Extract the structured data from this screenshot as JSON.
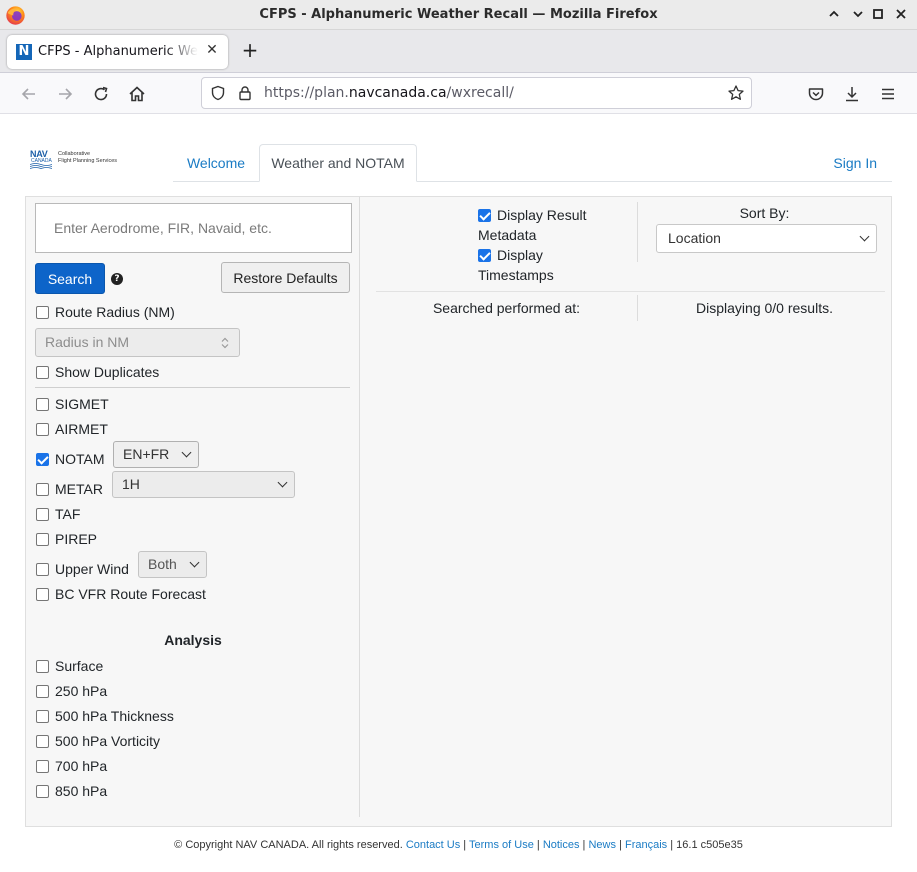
{
  "window": {
    "title": "CFPS - Alphanumeric Weather Recall — Mozilla Firefox"
  },
  "browser": {
    "tab_title": "CFPS - Alphanumeric Weather Recall",
    "favicon_letter": "N",
    "url_prefix": "https://plan.",
    "url_domain": "navcanada.ca",
    "url_path": "/wxrecall/"
  },
  "logo": {
    "brand": "NAV",
    "sub": "CANADA",
    "tagline_1": "Collaborative",
    "tagline_2": "Flight Planning Services"
  },
  "topnav": {
    "welcome": "Welcome",
    "weather_notam": "Weather and NOTAM",
    "sign_in": "Sign In"
  },
  "search": {
    "placeholder": "Enter Aerodrome, FIR, Navaid, etc.",
    "value": "",
    "search_label": "Search",
    "help": "?",
    "restore_label": "Restore Defaults"
  },
  "options": {
    "route_radius": {
      "label": "Route Radius (NM)",
      "checked": false
    },
    "radius_placeholder": "Radius in NM",
    "show_duplicates": {
      "label": "Show Duplicates",
      "checked": false
    }
  },
  "products": [
    {
      "label": "SIGMET",
      "checked": false
    },
    {
      "label": "AIRMET",
      "checked": false
    },
    {
      "label": "NOTAM",
      "checked": true,
      "select": "EN+FR"
    },
    {
      "label": "METAR",
      "checked": false,
      "select": "1H"
    },
    {
      "label": "TAF",
      "checked": false
    },
    {
      "label": "PIREP",
      "checked": false
    },
    {
      "label": "Upper Wind",
      "checked": false,
      "select": "Both"
    },
    {
      "label": "BC VFR Route Forecast",
      "checked": false
    }
  ],
  "analysis": {
    "heading": "Analysis",
    "items": [
      {
        "label": "Surface",
        "checked": false
      },
      {
        "label": "250 hPa",
        "checked": false
      },
      {
        "label": "500 hPa Thickness",
        "checked": false
      },
      {
        "label": "500 hPa Vorticity",
        "checked": false
      },
      {
        "label": "700 hPa",
        "checked": false
      },
      {
        "label": "850 hPa",
        "checked": false
      }
    ]
  },
  "results": {
    "display_metadata_line1": "Display Result",
    "display_metadata_line2": "Metadata",
    "display_timestamps_line1": "Display",
    "display_timestamps_line2": "Timestamps",
    "sort_by_label": "Sort By:",
    "sort_by_value": "Location",
    "searched_at": "Searched performed at:",
    "displaying": "Displaying 0/0 results."
  },
  "footer": {
    "copyright": "© Copyright NAV CANADA. All rights reserved.",
    "contact": "Contact Us",
    "terms": "Terms of Use",
    "notices": "Notices",
    "news": "News",
    "francais": "Français",
    "version": "16.1 c505e35"
  },
  "colors": {
    "accent": "#0d64c9",
    "link": "#1a7bc4",
    "checkbox": "#1a73e8"
  }
}
